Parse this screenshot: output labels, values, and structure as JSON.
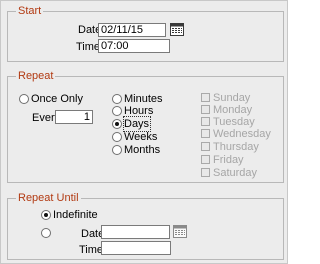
{
  "start": {
    "legend": "Start",
    "date_label": "Date",
    "date_value": "02/11/15",
    "time_label": "Time",
    "time_value": "07:00"
  },
  "repeat": {
    "legend": "Repeat",
    "once_only_label": "Once Only",
    "every_label": "Every",
    "every_value": "1",
    "units": [
      "Minutes",
      "Hours",
      "Days",
      "Weeks",
      "Months"
    ],
    "selected_unit": "Days",
    "weekdays": [
      "Sunday",
      "Monday",
      "Tuesday",
      "Wednesday",
      "Thursday",
      "Friday",
      "Saturday"
    ]
  },
  "repeat_until": {
    "legend": "Repeat Until",
    "indefinite_label": "Indefinite",
    "date_label": "Date",
    "date_value": "",
    "time_label": "Time",
    "time_value": ""
  }
}
